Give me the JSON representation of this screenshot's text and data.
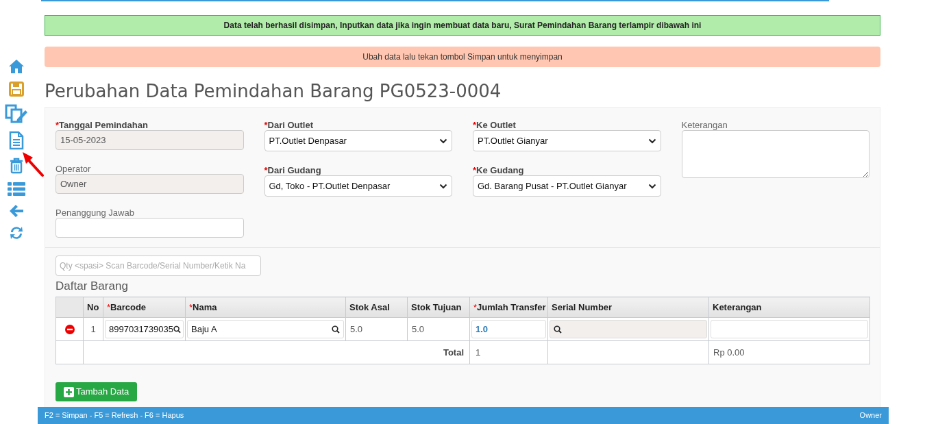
{
  "sidebar": {
    "items": [
      {
        "kind": "home"
      },
      {
        "kind": "save"
      },
      {
        "kind": "edit"
      },
      {
        "kind": "document"
      },
      {
        "kind": "trash"
      },
      {
        "kind": "list"
      },
      {
        "kind": "back"
      },
      {
        "kind": "refresh"
      }
    ]
  },
  "annotation": {
    "kind": "arrow"
  },
  "alerts": [
    {
      "kind": "success",
      "text": "Data telah berhasil disimpan, Inputkan data jika ingin membuat data baru, Surat Pemindahan Barang terlampir dibawah ini"
    },
    {
      "kind": "warning",
      "text": "Ubah data lalu tekan tombol Simpan untuk menyimpan"
    }
  ],
  "title": "Perubahan Data Pemindahan Barang PG0523-0004",
  "form": {
    "columns": [
      [
        {
          "kind": "readonly",
          "label": "Tanggal Pemindahan",
          "required_mark": "*",
          "value": "15-05-2023"
        },
        {
          "kind": "readonly",
          "label": "Operator",
          "value": "Owner"
        },
        {
          "kind": "text",
          "label": "Penanggung Jawab"
        }
      ],
      [
        {
          "kind": "select",
          "label": "Dari Outlet",
          "required_mark": "*",
          "value": "PT.Outlet Denpasar"
        },
        {
          "kind": "select",
          "label": "Dari Gudang",
          "required_mark": "*",
          "value": "Gd, Toko - PT.Outlet Denpasar"
        }
      ],
      [
        {
          "kind": "select",
          "label": "Ke Outlet",
          "required_mark": "*",
          "value": "PT.Outlet Gianyar"
        },
        {
          "kind": "select",
          "label": "Ke Gudang",
          "required_mark": "*",
          "value": "Gd. Barang Pusat - PT.Outlet Gianyar"
        }
      ],
      [
        {
          "kind": "textarea",
          "label": "Keterangan"
        }
      ]
    ]
  },
  "scan": {
    "placeholder": "Qty <spasi> Scan Barcode/Serial Number/Ketik Na"
  },
  "section_title": "Daftar Barang",
  "table": {
    "columns": [
      {
        "label": "No"
      },
      {
        "label": "Barcode",
        "required_mark": "*"
      },
      {
        "label": "Nama",
        "required_mark": "*"
      },
      {
        "label": "Stok Asal"
      },
      {
        "label": "Stok Tujuan"
      },
      {
        "label": "Jumlah Transfer",
        "required_mark": "*"
      },
      {
        "label": "Serial Number"
      },
      {
        "label": "Keterangan"
      }
    ],
    "rows": [
      {
        "no": "1",
        "barcode": "8997031739035",
        "nama": "Baju A",
        "stok_asal": "5.0",
        "stok_tujuan": "5.0",
        "jumlah": "1.0"
      }
    ],
    "total": {
      "label": "Total",
      "jumlah": "1",
      "keterangan": "Rp 0.00"
    }
  },
  "add_button": "Tambah Data",
  "footer": {
    "shortcuts": "F2 = Simpan - F5 = Refresh - F6 = Hapus",
    "user": "Owner"
  }
}
